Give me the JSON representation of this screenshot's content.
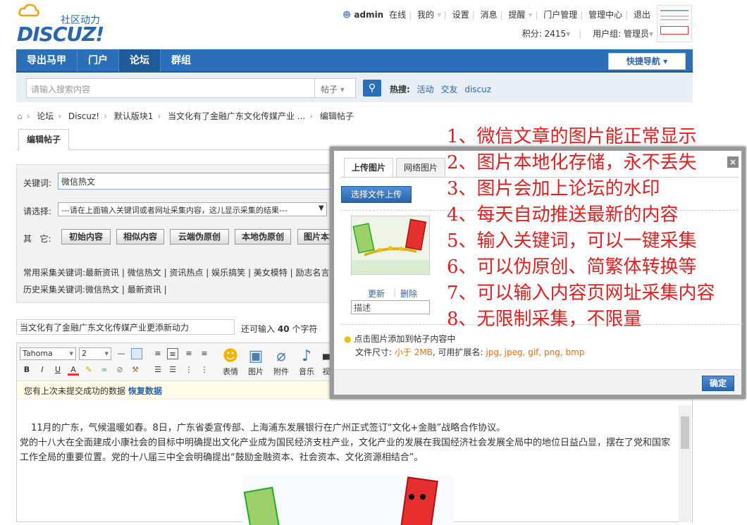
{
  "header": {
    "logo_sub": "社区动力",
    "logo_text": "DISCUZ!",
    "user": "admin",
    "online": "在线",
    "links": [
      "我的",
      "设置",
      "消息",
      "提醒",
      "门户管理",
      "管理中心",
      "退出"
    ],
    "points": "积分: 2415",
    "group": "用户组: 管理员"
  },
  "nav": {
    "items": [
      "导出马甲",
      "门户",
      "论坛",
      "群组"
    ],
    "active_index": 2,
    "quick_nav": "快捷导航"
  },
  "search": {
    "placeholder": "请输入搜索内容",
    "type": "帖子",
    "hot_label": "热搜:",
    "hot_terms": [
      "活动",
      "交友",
      "discuz"
    ]
  },
  "breadcrumb": [
    "论坛",
    "Discuz!",
    "默认版块1",
    "当文化有了金融广东文化传媒产业 ...",
    "编辑帖子"
  ],
  "tab": "编辑帖子",
  "collect": {
    "keyword_label": "关键词:",
    "keyword_value": "微信热文",
    "select_label": "请选择:",
    "select_value": "---请在上面输入关键词或者网址采集内容，这儿显示采集的结果---",
    "other_label": "其   它:",
    "buttons": [
      "初始内容",
      "相似内容",
      "云端伪原创",
      "本地伪原创",
      "图片本地"
    ],
    "common_label": "常用采集关键词:",
    "common_keywords": [
      "最新资讯",
      "微信热文",
      "资讯热点",
      "娱乐搞笑",
      "美女模特",
      "励志名言"
    ],
    "history_label": "历史采集关键词:",
    "history_keywords": [
      "微信热文",
      "最新资讯"
    ]
  },
  "title": {
    "value": "当文化有了金融广东文化传媒产业更添新动力",
    "remain_prefix": "还可输入",
    "remain_count": "40",
    "remain_suffix": "个字符"
  },
  "editor": {
    "font": "Tahoma",
    "size": "2",
    "big_buttons": [
      "表情",
      "图片",
      "附件",
      "音乐",
      "视"
    ],
    "notice": "您有上次未提交成功的数据",
    "restore": "恢复数据",
    "para1": "11月的广东，气候温暖如春。8日，广东省委宣传部、上海浦东发展银行在广州正式签订“文化+金融”战略合作协议。",
    "para2": "党的十八大在全面建成小康社会的目标中明确提出文化产业成为国民经济支柱产业，文化产业的发展在我国经济社会发展全局中的地位日益凸显，摆在了党和国家工作全局的重要位置。党的十八届三中全会明确提出“鼓励金融资本、社会资本、文化资源相结合”。"
  },
  "dialog": {
    "tabs": [
      "上传图片",
      "网络图片"
    ],
    "upload_button": "选择文件上传",
    "update": "更新",
    "delete": "删除",
    "desc_placeholder": "描述",
    "tip": "点击图片添加到帖子内容中",
    "size_label": "文件尺寸:",
    "size_limit": "小于 2MB",
    "ext_label": ", 可用扩展名:",
    "ext_list": "jpg, jpeg, gif, png, bmp",
    "ok": "确定",
    "close": "×"
  },
  "features": [
    "1、微信文章的图片能正常显示",
    "2、图片本地化存储，永不丢失",
    "3、图片会加上论坛的水印",
    "4、每天自动推送最新的内容",
    "5、输入关键词，可以一键采集",
    "6、可以伪原创、简繁体转换等",
    "7、可以输入内容页网址采集内容",
    "8、无限制采集，不限量"
  ],
  "colors": {
    "brand": "#2b6fb8",
    "feature_red": "#e02020",
    "orange": "#ff6600"
  }
}
